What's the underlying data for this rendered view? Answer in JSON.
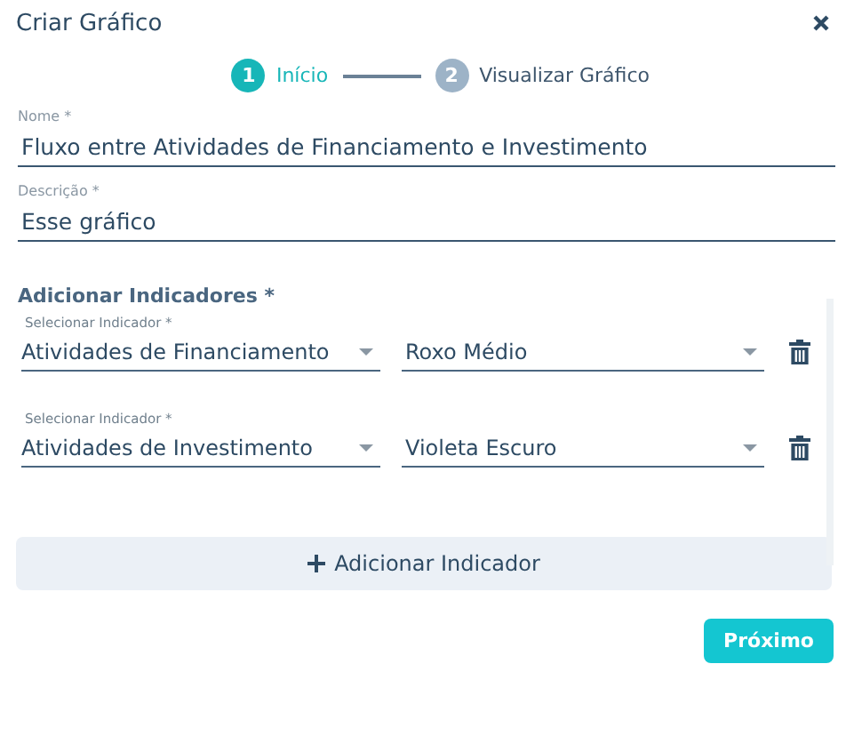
{
  "window": {
    "title": "Criar Gráfico"
  },
  "steps": [
    {
      "number": "1",
      "label": "Início",
      "selected": true
    },
    {
      "number": "2",
      "label": "Visualizar Gráfico",
      "selected": false
    }
  ],
  "fields": [
    {
      "label": "Nome *",
      "value": "Fluxo entre Atividades de Financiamento e Investimento"
    },
    {
      "label": "Descrição *",
      "value": "Esse gráfico"
    }
  ],
  "indicators_section": {
    "title": "Adicionar Indicadores *",
    "rows": [
      {
        "label": "Selecionar Indicador *",
        "indicator": "Atividades de Financiamento",
        "color_name": "Roxo Médio"
      },
      {
        "label": "Selecionar Indicador *",
        "indicator": "Atividades de Investimento",
        "color_name": "Violeta Escuro"
      }
    ]
  },
  "add_button": "Adicionar Indicador",
  "next_button": "Próximo"
}
